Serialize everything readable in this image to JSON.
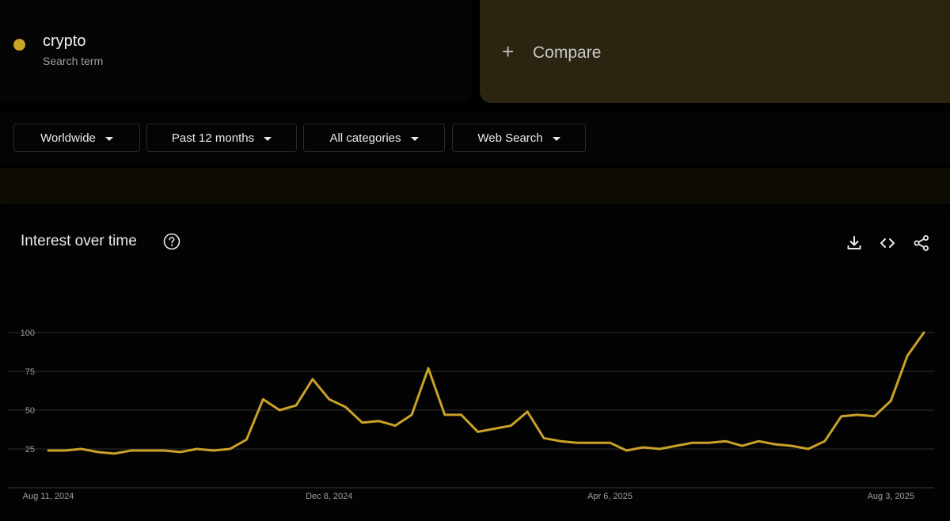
{
  "colors": {
    "series": "#c9a227",
    "compare_bg": "#2a2410",
    "grid": "#2e2e2e"
  },
  "term": {
    "name": "crypto",
    "subtitle": "Search term",
    "icon": "color-dot"
  },
  "compare": {
    "icon": "plus-icon",
    "label": "Compare"
  },
  "filters": [
    {
      "label": "Worldwide",
      "icon": "caret-down-icon"
    },
    {
      "label": "Past 12 months",
      "icon": "caret-down-icon"
    },
    {
      "label": "All categories",
      "icon": "caret-down-icon"
    },
    {
      "label": "Web Search",
      "icon": "caret-down-icon"
    }
  ],
  "panel": {
    "title": "Interest over time",
    "help_icon": "help-circle-icon",
    "actions": [
      "download-icon",
      "embed-code-icon",
      "share-icon"
    ]
  },
  "chart_data": {
    "type": "line",
    "ylim": [
      0,
      100
    ],
    "yticks": [
      25,
      50,
      75,
      100
    ],
    "xtick_labels": [
      "Aug 11, 2024",
      "Dec 8, 2024",
      "Apr 6, 2025",
      "Aug 3, 2025"
    ],
    "grid": true,
    "series": [
      {
        "values": [
          24,
          24,
          25,
          23,
          22,
          24,
          24,
          24,
          23,
          25,
          24,
          25,
          31,
          57,
          50,
          53,
          70,
          57,
          52,
          42,
          43,
          40,
          47,
          77,
          47,
          47,
          36,
          38,
          40,
          49,
          32,
          30,
          29,
          29,
          29,
          24,
          26,
          25,
          27,
          29,
          29,
          30,
          27,
          30,
          28,
          27,
          25,
          30,
          46,
          47,
          46,
          56,
          85,
          100
        ]
      }
    ]
  }
}
